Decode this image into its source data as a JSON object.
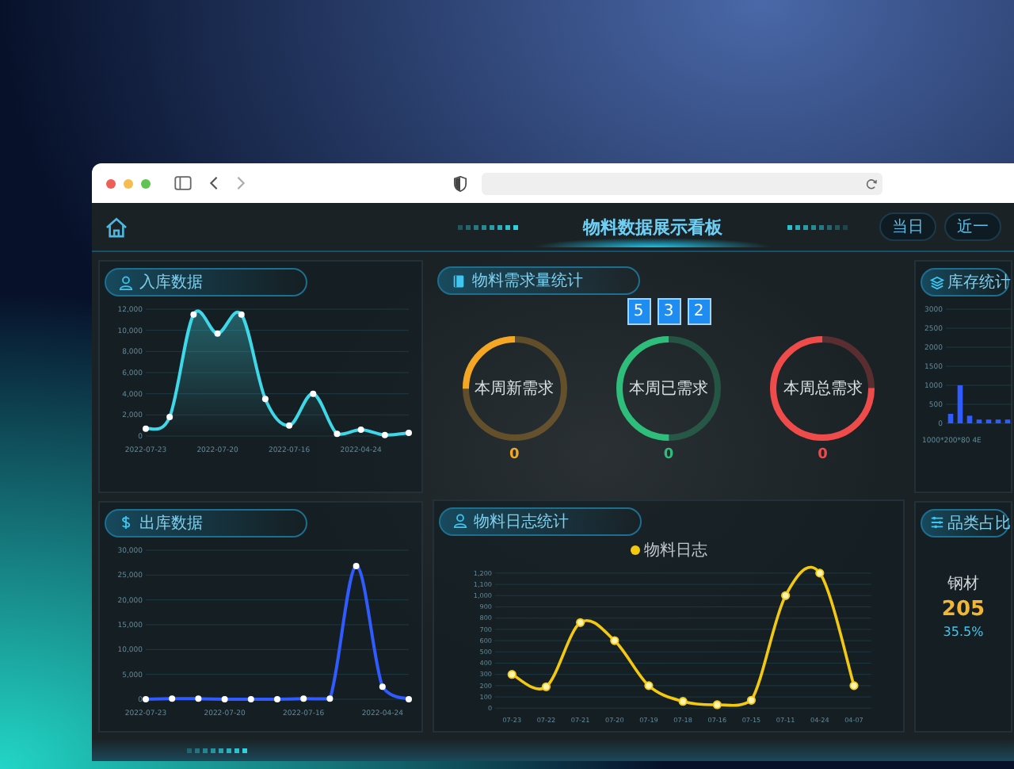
{
  "header": {
    "title": "物料数据展示看板",
    "buttons": [
      {
        "label": "当日"
      },
      {
        "label": "近一"
      }
    ]
  },
  "in_stock": {
    "title": "入库数据",
    "chart_data": {
      "type": "area",
      "grid": true,
      "categories": [
        "2022-07-23",
        null,
        null,
        "2022-07-20",
        null,
        null,
        "2022-07-16",
        null,
        null,
        "2022-04-24",
        null,
        null
      ],
      "series": [
        {
          "color": "#3fd8e8",
          "marker": "circle",
          "values": [
            700,
            1800,
            11500,
            9700,
            11500,
            3500,
            1000,
            4000,
            200,
            600,
            100,
            300
          ]
        }
      ],
      "ylim": [
        0,
        12000
      ],
      "yticks": [
        {
          "value": 0,
          "label": "0"
        },
        {
          "value": 2000,
          "label": "2,000"
        },
        {
          "value": 4000,
          "label": "4,000"
        },
        {
          "value": 6000,
          "label": "6,000"
        },
        {
          "value": 8000,
          "label": "8,000"
        },
        {
          "value": 10000,
          "label": "10,000"
        },
        {
          "value": 12000,
          "label": "12,000"
        }
      ]
    }
  },
  "out_stock": {
    "title": "出库数据",
    "chart_data": {
      "type": "line",
      "grid": true,
      "categories": [
        "2022-07-23",
        null,
        null,
        "2022-07-20",
        null,
        null,
        "2022-07-16",
        null,
        null,
        "2022-04-24",
        null
      ],
      "series": [
        {
          "color": "#2f5bff",
          "marker": "circle",
          "values": [
            0,
            100,
            100,
            0,
            0,
            0,
            100,
            100,
            26800,
            2500,
            0
          ]
        }
      ],
      "ylim": [
        0,
        30000
      ],
      "yticks": [
        {
          "value": 0,
          "label": "0"
        },
        {
          "value": 5000,
          "label": "5,000"
        },
        {
          "value": 10000,
          "label": "10,000"
        },
        {
          "value": 15000,
          "label": "15,000"
        },
        {
          "value": 20000,
          "label": "20,000"
        },
        {
          "value": 25000,
          "label": "25,000"
        },
        {
          "value": 30000,
          "label": "30,000"
        }
      ]
    }
  },
  "demand": {
    "title": "物料需求量统计",
    "digits": [
      "5",
      "3",
      "2"
    ],
    "gauges": [
      {
        "label": "本周新需求",
        "value": "0",
        "level": 0.25,
        "color": "#f5a623"
      },
      {
        "label": "本周已需求",
        "value": "0",
        "level": 0.5,
        "color": "#2ebd7a"
      },
      {
        "label": "本周总需求",
        "value": "0",
        "level": 0.75,
        "color": "#f04b4b"
      }
    ]
  },
  "material_log": {
    "title": "物料日志统计",
    "chart_data": {
      "type": "line",
      "grid": true,
      "categories": [
        "07-23",
        "07-22",
        "07-21",
        "07-20",
        "07-19",
        "07-18",
        "07-16",
        "07-15",
        "07-11",
        "04-24",
        "04-07"
      ],
      "series": [
        {
          "name": "物料日志",
          "color": "#f2c811",
          "marker": "circle",
          "values": [
            300,
            190,
            760,
            600,
            200,
            60,
            30,
            70,
            1000,
            1200,
            200
          ]
        }
      ],
      "ylim": [
        0,
        1200
      ],
      "yticks": [
        {
          "value": 0,
          "label": "0"
        },
        {
          "value": 100,
          "label": "100"
        },
        {
          "value": 200,
          "label": "200"
        },
        {
          "value": 300,
          "label": "300"
        },
        {
          "value": 400,
          "label": "400"
        },
        {
          "value": 500,
          "label": "500"
        },
        {
          "value": 600,
          "label": "600"
        },
        {
          "value": 700,
          "label": "700"
        },
        {
          "value": 800,
          "label": "800"
        },
        {
          "value": 900,
          "label": "900"
        },
        {
          "value": 1000,
          "label": "1,000"
        },
        {
          "value": 1100,
          "label": "1,100"
        },
        {
          "value": 1200,
          "label": "1,200"
        }
      ]
    }
  },
  "inventory": {
    "title": "库存统计",
    "chart_data": {
      "type": "bar",
      "grid": true,
      "xlabel": "1000*200*80 4E",
      "series": [
        {
          "color": "#2f5bff",
          "values": [
            250,
            1000,
            200,
            100,
            100,
            100,
            100
          ]
        }
      ],
      "ylim": [
        0,
        3000
      ],
      "yticks": [
        {
          "value": 0,
          "label": "0"
        },
        {
          "value": 500,
          "label": "500"
        },
        {
          "value": 1000,
          "label": "1000"
        },
        {
          "value": 1500,
          "label": "1500"
        },
        {
          "value": 2000,
          "label": "2000"
        },
        {
          "value": 2500,
          "label": "2500"
        },
        {
          "value": 3000,
          "label": "3000"
        }
      ]
    }
  },
  "category_share": {
    "title": "品类占比",
    "label": "钢材",
    "value": "205",
    "percent": "35.5%"
  }
}
